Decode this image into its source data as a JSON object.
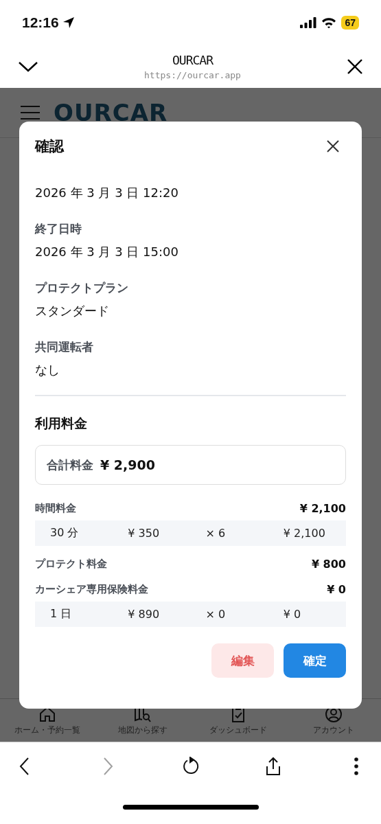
{
  "status_bar": {
    "time": "12:16",
    "battery": "67"
  },
  "browser": {
    "title": "OURCAR",
    "url": "https://ourcar.app"
  },
  "page": {
    "logo": "OURCAR",
    "nav": [
      {
        "label": "ホーム・予約一覧",
        "kind": "home"
      },
      {
        "label": "地図から探す",
        "kind": "map"
      },
      {
        "label": "ダッシュボード",
        "kind": "dashboard"
      },
      {
        "label": "アカウント",
        "kind": "account"
      }
    ]
  },
  "dialog": {
    "title": "確認",
    "fields": [
      {
        "value": "2026 年 3 月 3 日 12:20"
      },
      {
        "label": "終了日時",
        "value": "2026 年 3 月 3 日 15:00"
      },
      {
        "label": "プロテクトプラン",
        "value": "スタンダード"
      },
      {
        "label": "共同運転者",
        "value": "なし"
      }
    ],
    "section_title": "利用料金",
    "total": {
      "label": "合計料金",
      "value": "¥ 2,900"
    },
    "fees": [
      {
        "label": "時間料金",
        "amount": "¥ 2,100",
        "breakdown": [
          "30 分",
          "¥ 350",
          "× 6",
          "¥ 2,100"
        ]
      },
      {
        "label": "プロテクト料金",
        "amount": "¥ 800"
      },
      {
        "label": "カーシェア専用保険料金",
        "amount": "¥ 0",
        "breakdown": [
          "1 日",
          "¥ 890",
          "× 0",
          "¥ 0"
        ]
      }
    ],
    "buttons": [
      {
        "label": "編集",
        "kind": "secondary"
      },
      {
        "label": "確定",
        "kind": "primary"
      }
    ]
  },
  "toolbar": [
    {
      "kind": "back",
      "disabled": false
    },
    {
      "kind": "forward",
      "disabled": true
    },
    {
      "kind": "reload",
      "disabled": false
    },
    {
      "kind": "share",
      "disabled": false
    },
    {
      "kind": "more",
      "disabled": false
    }
  ]
}
